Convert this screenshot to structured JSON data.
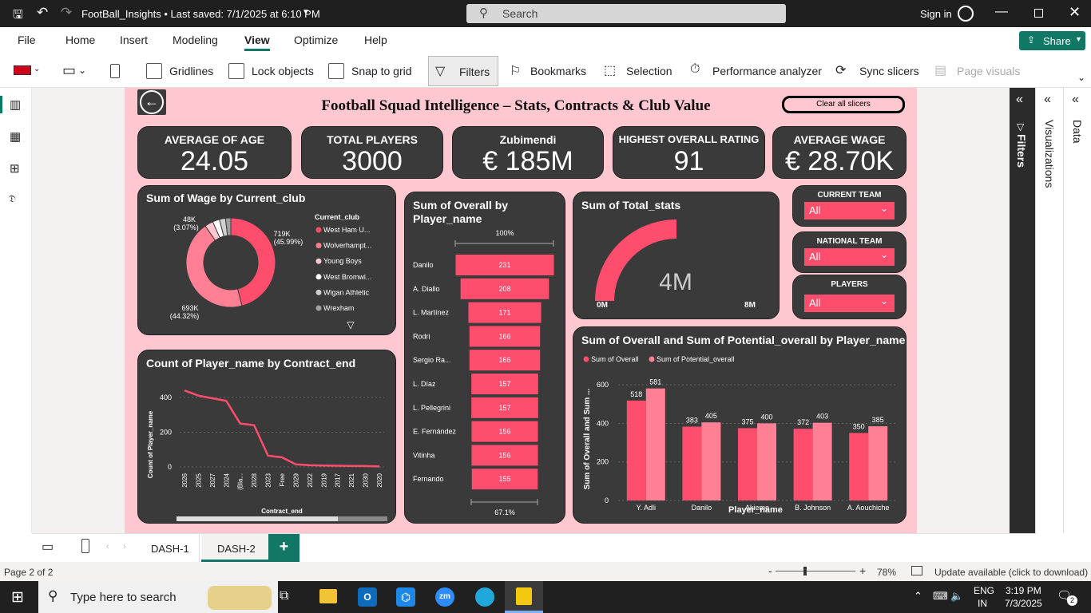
{
  "window": {
    "title": "FootBall_Insights • Last saved: 7/1/2025 at 6:10 PM",
    "search_placeholder": "Search",
    "signin": "Sign in"
  },
  "menu": {
    "items": [
      "File",
      "Home",
      "Insert",
      "Modeling",
      "View",
      "Optimize",
      "Help"
    ],
    "share": "Share"
  },
  "ribbon": {
    "gridlines": "Gridlines",
    "lock": "Lock objects",
    "snap": "Snap to grid",
    "filters": "Filters",
    "bookmarks": "Bookmarks",
    "selection": "Selection",
    "perf": "Performance analyzer",
    "sync": "Sync slicers",
    "pagevisuals": "Page visuals"
  },
  "report": {
    "title": "Football Squad Intelligence – Stats, Contracts & Club Value",
    "clear_btn": "Clear all slicers",
    "kpis": [
      {
        "title": "AVERAGE OF AGE",
        "value": "24.05"
      },
      {
        "title": "TOTAL PLAYERS",
        "value": "3000"
      },
      {
        "title": "Zubimendi",
        "value": "€ 185M"
      },
      {
        "title": "HIGHEST OVERALL RATING",
        "value": "91"
      },
      {
        "title": "AVERAGE WAGE",
        "value": "€ 28.70K"
      }
    ],
    "slicers": [
      {
        "title": "CURRENT TEAM",
        "value": "All"
      },
      {
        "title": "NATIONAL TEAM",
        "value": "All"
      },
      {
        "title": "PLAYERS",
        "value": "All"
      }
    ]
  },
  "donut": {
    "title": "Sum of Wage by Current_club",
    "legend_title": "Current_club",
    "legend": [
      "West Ham U...",
      "Wolverhampt...",
      "Young Boys",
      "West Bromwi...",
      "Wigan Athletic",
      "Wrexham"
    ],
    "labels": {
      "a_val": "719K",
      "a_pct": "(45.99%)",
      "b_val": "693K",
      "b_pct": "(44.32%)",
      "c_val": "48K",
      "c_pct": "(3.07%)"
    },
    "colors": {
      "a": "#ff4d6d",
      "b": "#ff7f95"
    }
  },
  "funnel": {
    "title_line1": "Sum of Overall by",
    "title_line2": "Player_name",
    "top_pct": "100%",
    "bottom_pct": "67.1%",
    "color": "#ff4d6d"
  },
  "gauge": {
    "title": "Sum of Total_stats",
    "value": "4M",
    "min": "0M",
    "max": "8M",
    "fraction": 0.5,
    "color": "#ff4d6d"
  },
  "line": {
    "title": "Count of Player_name by Contract_end",
    "ylabel": "Count of Player_name",
    "xlabel": "Contract_end",
    "color": "#ff4d6d"
  },
  "cluster": {
    "title": "Sum of Overall and Sum of Potential_overall by Player_name",
    "legend": [
      "Sum of Overall",
      "Sum of Potential_overall"
    ],
    "ylabel": "Sum of Overall and Sum ...",
    "xlabel": "Player_name",
    "colors": [
      "#ff4d6d",
      "#ff7f95"
    ]
  },
  "chart_data": [
    {
      "type": "pie",
      "title": "Sum of Wage by Current_club",
      "categories": [
        "West Ham U...",
        "Wolverhampt...",
        "Young Boys",
        "West Bromwi...",
        "Wigan Athletic",
        "Wrexham"
      ],
      "values": [
        45.99,
        44.32,
        3.07,
        2.5,
        2.2,
        1.92
      ]
    },
    {
      "type": "bar",
      "title": "Sum of Overall by Player_name",
      "categories": [
        "Danilo",
        "A. Diallo",
        "L. Martínez",
        "Rodri",
        "Sergio Ra...",
        "L. Díaz",
        "L. Pellegrini",
        "E. Fernández",
        "Vitinha",
        "Fernando"
      ],
      "values": [
        231,
        208,
        171,
        166,
        166,
        157,
        157,
        156,
        156,
        155
      ]
    },
    {
      "type": "line",
      "title": "Count of Player_name by Contract_end",
      "categories": [
        "2026",
        "2025",
        "2027",
        "2024",
        "(Bla...",
        "2028",
        "2023",
        "Free",
        "2029",
        "2022",
        "2019",
        "2017",
        "2021",
        "2030",
        "2020"
      ],
      "values": [
        440,
        410,
        395,
        380,
        250,
        240,
        65,
        55,
        15,
        10,
        8,
        7,
        6,
        5,
        3
      ],
      "ylim": [
        0,
        450
      ],
      "yticks": [
        0,
        200,
        400
      ]
    },
    {
      "type": "bar",
      "title": "Sum of Overall and Sum of Potential_overall by Player_name",
      "categories": [
        "Y. Adli",
        "Danilo",
        "Akieme",
        "B. Johnson",
        "A. Aouchiche"
      ],
      "series": [
        {
          "name": "Sum of Overall",
          "values": [
            518,
            383,
            375,
            372,
            350
          ]
        },
        {
          "name": "Sum of Potential_overall",
          "values": [
            581,
            405,
            400,
            403,
            385
          ]
        }
      ],
      "ylim": [
        0,
        650
      ],
      "yticks": [
        0,
        200,
        400,
        600
      ]
    }
  ],
  "panes": {
    "filters": "Filters",
    "visualizations": "Visualizations",
    "data": "Data"
  },
  "tabs": {
    "items": [
      "DASH-1",
      "DASH-2"
    ],
    "add": "+"
  },
  "status": {
    "page": "Page 2 of 2",
    "zoom": "78%",
    "update": "Update available (click to download)"
  },
  "taskbar": {
    "search": "Type here to search",
    "lang1": "ENG",
    "lang2": "IN",
    "time": "3:19 PM",
    "date": "7/3/2025",
    "notif": "2"
  }
}
